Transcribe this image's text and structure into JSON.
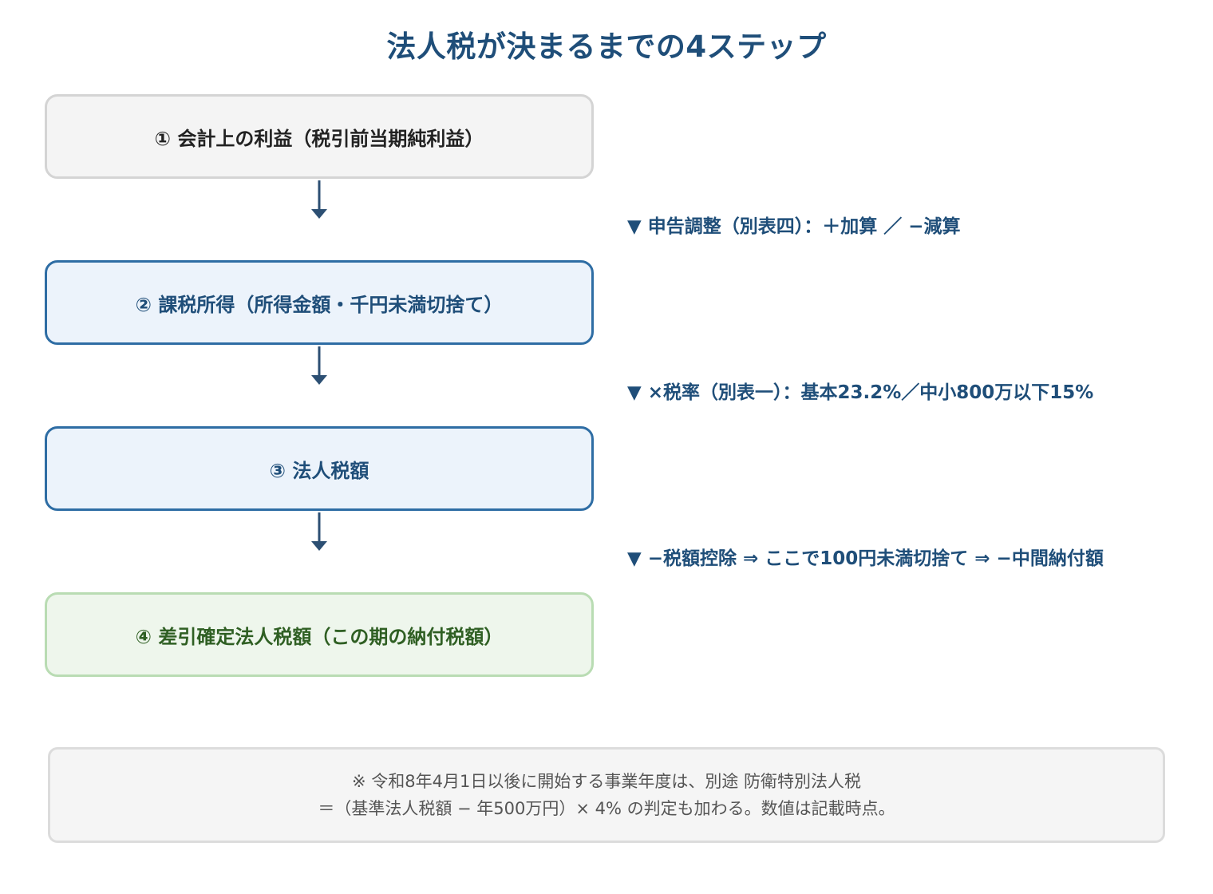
{
  "title": "法人税が決まるまでの4ステップ",
  "steps": [
    {
      "label": "① 会計上の利益（税引前当期純利益）"
    },
    {
      "label": "② 課税所得（所得金額・千円未満切捨て）"
    },
    {
      "label": "③ 法人税額"
    },
    {
      "label": "④ 差引確定法人税額（この期の納付税額）"
    }
  ],
  "transitions": [
    {
      "label": "▼ 申告調整（別表四）：＋加算 ／ −減算"
    },
    {
      "label": "▼ ×税率（別表一）：基本23.2%／中小800万以下15%"
    },
    {
      "label": "▼ −税額控除 ⇒ ここで100円未満切捨て ⇒ −中間納付額"
    }
  ],
  "footnote": {
    "line1": "※ 令和8年4月1日以後に開始する事業年度は、別途 防衛特別法人税",
    "line2": "＝（基準法人税額 − 年500万円）× 4% の判定も加わる。数値は記載時点。"
  },
  "colors": {
    "title": "#1f4e79",
    "arrow": "#2c4f73",
    "neutral_fill": "#f4f4f4",
    "blue_fill": "#ecf3fb",
    "blue_border": "#2e6da4",
    "green_fill": "#eef6ec",
    "green_border": "#b9dcb3",
    "green_text": "#2f5f23"
  }
}
